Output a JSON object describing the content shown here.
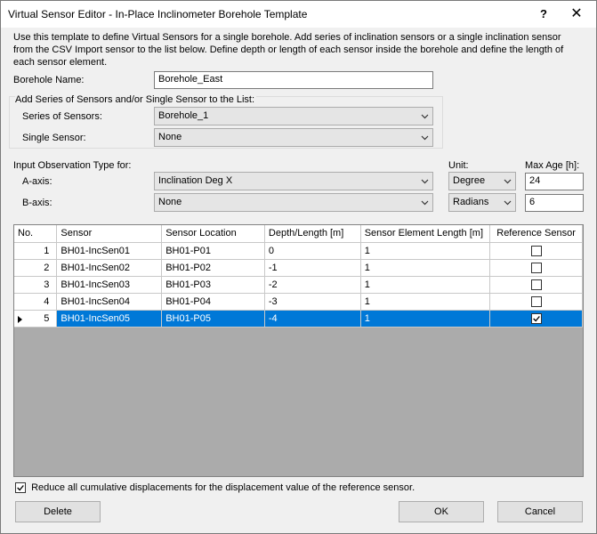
{
  "window": {
    "title": "Virtual Sensor Editor - In-Place Inclinometer Borehole Template",
    "help_label": "?",
    "close_label": "✕"
  },
  "description": "Use this template to define Virtual Sensors for a single borehole. Add series of inclination sensors or a single inclination sensor from the CSV Import sensor to the list below. Define depth or length of each sensor inside the borehole and define the length of each sensor element.",
  "borehole": {
    "label": "Borehole Name:",
    "value": "Borehole_East"
  },
  "add_group": {
    "title": "Add Series of Sensors and/or Single Sensor to the List:",
    "series_label": "Series of Sensors:",
    "series_value": "Borehole_1",
    "single_label": "Single Sensor:",
    "single_value": "None"
  },
  "observation": {
    "title": "Input Observation Type for:",
    "a_label": "A-axis:",
    "a_value": "Inclination Deg X",
    "b_label": "B-axis:",
    "b_value": "None",
    "unit_label": "Unit:",
    "a_unit": "Degree",
    "b_unit": "Radians",
    "maxage_label": "Max Age [h]:",
    "a_maxage": "24",
    "b_maxage": "6"
  },
  "grid": {
    "columns": [
      "No.",
      "Sensor",
      "Sensor Location",
      "Depth/Length [m]",
      "Sensor Element Length [m]",
      "Reference Sensor"
    ],
    "rows": [
      {
        "no": "1",
        "sensor": "BH01-IncSen01",
        "location": "BH01-P01",
        "depth": "0",
        "element_length": "1",
        "reference": false
      },
      {
        "no": "2",
        "sensor": "BH01-IncSen02",
        "location": "BH01-P02",
        "depth": "-1",
        "element_length": "1",
        "reference": false
      },
      {
        "no": "3",
        "sensor": "BH01-IncSen03",
        "location": "BH01-P03",
        "depth": "-2",
        "element_length": "1",
        "reference": false
      },
      {
        "no": "4",
        "sensor": "BH01-IncSen04",
        "location": "BH01-P04",
        "depth": "-3",
        "element_length": "1",
        "reference": false
      },
      {
        "no": "5",
        "sensor": "BH01-IncSen05",
        "location": "BH01-P05",
        "depth": "-4",
        "element_length": "1",
        "reference": true
      }
    ],
    "selected_row": 4
  },
  "reduce_option": {
    "label": "Reduce all cumulative displacements for the displacement value of the reference sensor.",
    "checked": true
  },
  "buttons": {
    "delete": "Delete",
    "ok": "OK",
    "cancel": "Cancel"
  },
  "colors": {
    "selection": "#0078d7",
    "window_bg": "#f0f0f0"
  }
}
